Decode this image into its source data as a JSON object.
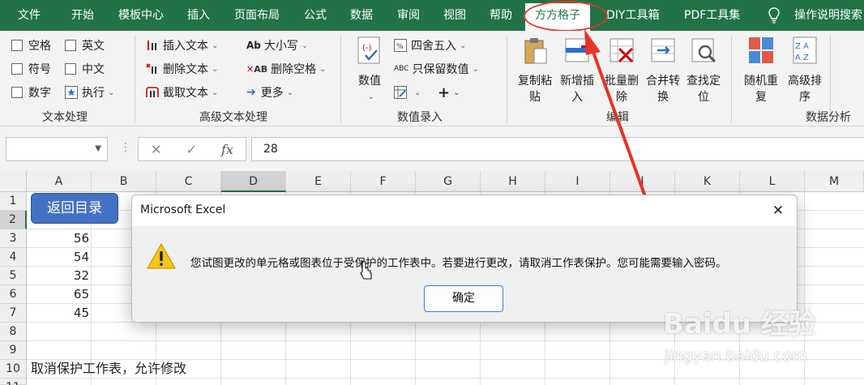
{
  "tabs": [
    "文件",
    "开始",
    "模板中心",
    "插入",
    "页面布局",
    "公式",
    "数据",
    "审阅",
    "视图",
    "帮助",
    "方方格子",
    "DIY工具箱",
    "PDF工具集"
  ],
  "active_tab": "方方格子",
  "tell_me": "操作说明搜索",
  "ribbon": {
    "text_proc": {
      "checkboxes": [
        "空格",
        "英文",
        "符号",
        "中文",
        "数字"
      ],
      "exec": "执行",
      "label": "文本处理"
    },
    "adv_text": {
      "insert": "插入文本",
      "delete": "删除文本",
      "extract": "截取文本",
      "case": "大小写",
      "del_space": "删除空格",
      "more": "更多",
      "label": "高级文本处理"
    },
    "num_entry": {
      "value": "数值",
      "round": "四舍五入",
      "keep_value": "只保留数值",
      "label": "数值录入"
    },
    "edit": {
      "copy_paste": [
        "复制粘",
        "贴"
      ],
      "new_insert": [
        "新增插",
        "入"
      ],
      "batch_delete": [
        "批量删",
        "除"
      ],
      "merge_convert": [
        "合并转",
        "换"
      ],
      "find_locate": [
        "查找定",
        "位"
      ],
      "label": "编辑"
    },
    "analysis": {
      "random": [
        "随机重",
        "复"
      ],
      "adv_sort": [
        "高级排",
        "序"
      ],
      "label": "数据分析"
    }
  },
  "formula_bar": {
    "name_box": "",
    "value": "28"
  },
  "sheet": {
    "columns": [
      "A",
      "B",
      "C",
      "D",
      "E",
      "F",
      "G",
      "H",
      "I",
      "J",
      "K",
      "L",
      "M"
    ],
    "rows": [
      "1",
      "2",
      "3",
      "4",
      "5",
      "6",
      "7",
      "8",
      "9",
      "10",
      "11"
    ],
    "back_button": "返回目录",
    "col_a_values": [
      "56",
      "54",
      "32",
      "65",
      "45"
    ],
    "note": "取消保护工作表，允许修改"
  },
  "dialog": {
    "title": "Microsoft Excel",
    "message": "您试图更改的单元格或图表位于受保护的工作表中。若要进行更改，请取消工作表保护。您可能需要输入密码。",
    "ok": "确定"
  },
  "watermark": {
    "brand": "Baidu 经验",
    "url": "jingyan.baidu.com"
  },
  "colors": {
    "excel_green": "#217346",
    "annotation_red": "#e8332a",
    "button_blue": "#4472c4"
  }
}
